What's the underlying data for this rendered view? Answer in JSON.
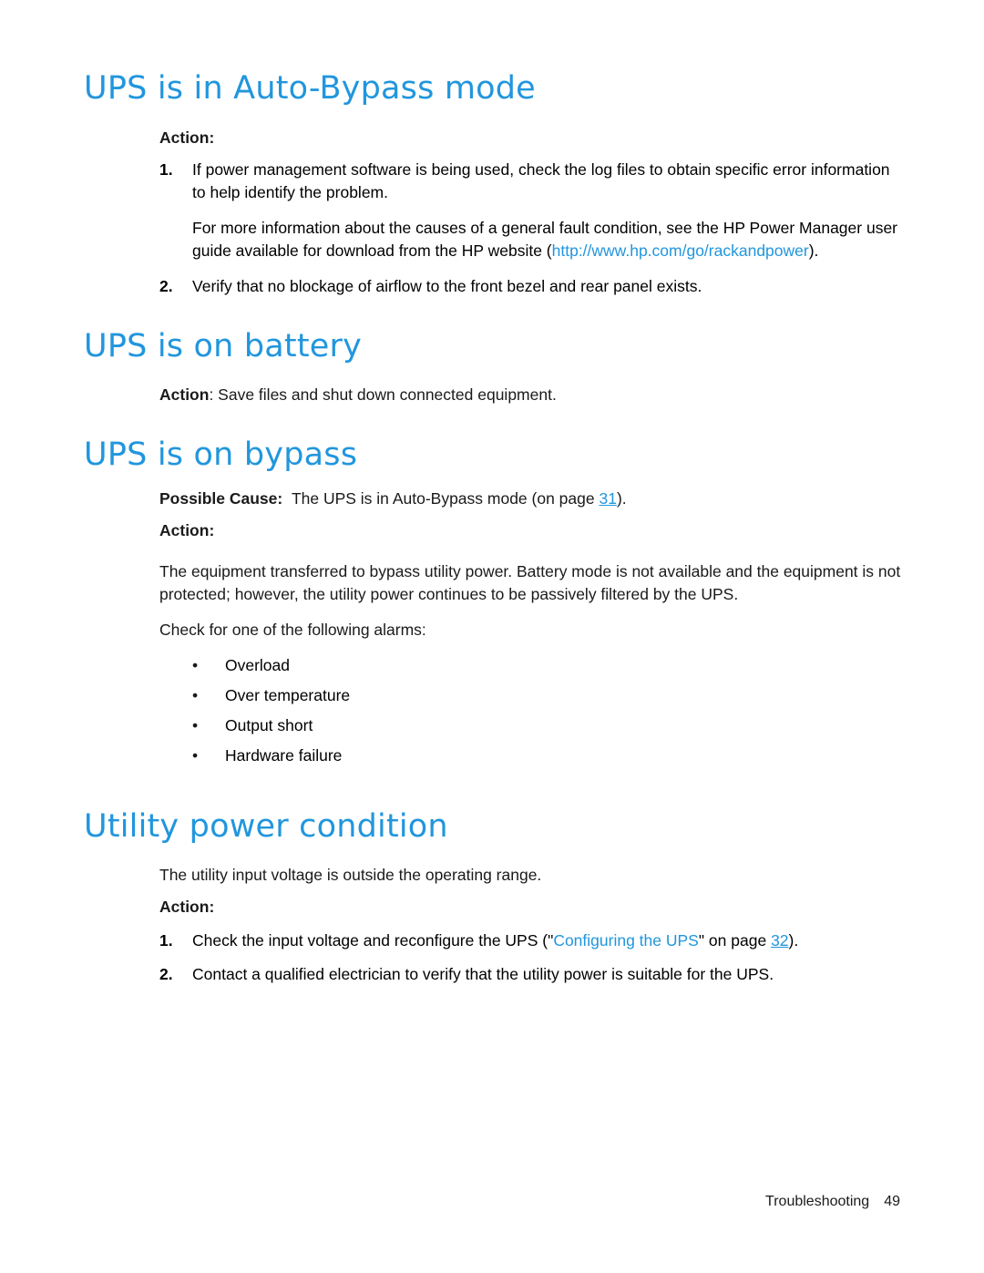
{
  "document": {
    "footer_label": "Troubleshooting",
    "footer_page": "49"
  },
  "sections": [
    {
      "id": "auto-bypass",
      "title": "UPS is in Auto-Bypass mode",
      "action_label": "Action:",
      "items": [
        {
          "num": "1.",
          "text": "If power management software is being used, check the log files to obtain specific error information to help identify the problem."
        },
        {
          "num": "2.",
          "text": "Verify that no blockage of airflow to the front bezel and rear panel exists."
        }
      ],
      "sub_paragraph": {
        "lead": "For more information about the causes of a general fault condition, see the HP Power Manager user guide available for download from the HP website (",
        "link": "http://www.hp.com/go/rackandpower",
        "tail": ")."
      }
    },
    {
      "id": "on-battery",
      "title": "UPS is on battery",
      "action_label": "Action",
      "action_text": ": Save files and shut down connected equipment."
    },
    {
      "id": "on-bypass",
      "title": "UPS is on bypass",
      "possible_cause_label": "Possible Cause:",
      "possible_cause_text_pre": "The UPS is in Auto-Bypass mode (on page ",
      "possible_cause_page": "31",
      "possible_cause_text_post": ").",
      "action_label": "Action:",
      "paragraph1": "The equipment transferred to bypass utility power. Battery mode is not available and the equipment is not protected; however, the utility power continues to be passively filtered by the UPS.",
      "paragraph2": "Check for one of the following alarms:",
      "alarms": [
        "Overload",
        "Over temperature",
        "Output short",
        "Hardware failure"
      ]
    },
    {
      "id": "utility-power",
      "title": "Utility power condition",
      "paragraph1": "The utility input voltage is outside the operating range.",
      "action_label": "Action:",
      "items": [
        {
          "num": "1.",
          "pre": "Check the input voltage and reconfigure the UPS (\"",
          "link": "Configuring the UPS",
          "mid": "\" on page ",
          "page": "32",
          "post": ")."
        },
        {
          "num": "2.",
          "text": "Contact a qualified electrician to verify that the utility power is suitable for the UPS."
        }
      ]
    }
  ]
}
